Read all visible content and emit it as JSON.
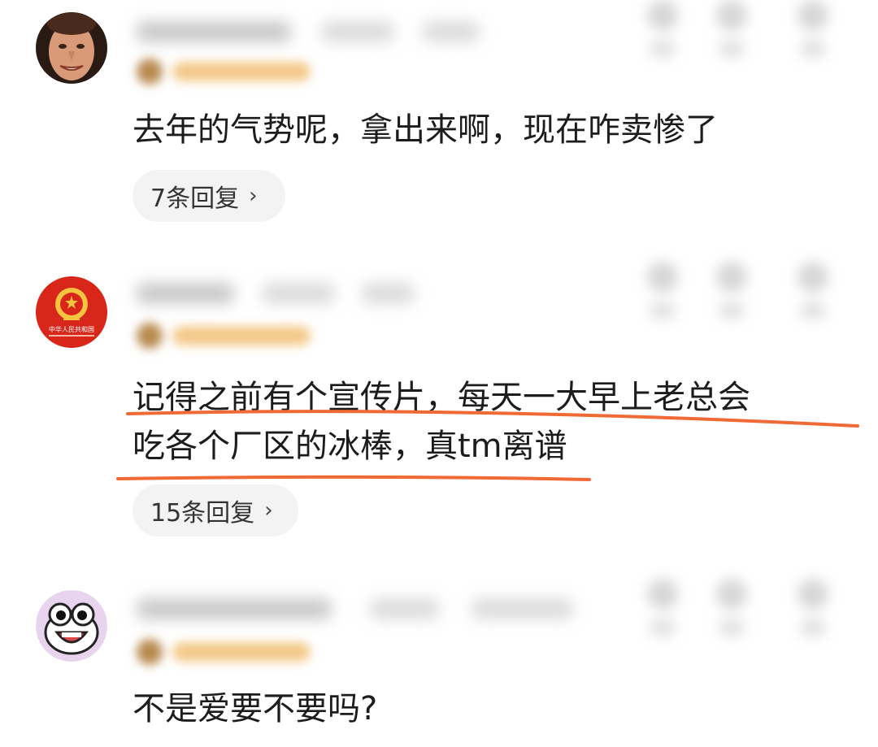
{
  "comments": [
    {
      "text_lines": [
        "去年的气势呢，拿出来啊，现在咋卖惨了"
      ],
      "reply_label": "7条回复",
      "reply_chevron": "›",
      "avatar_icon": "face-photo-avatar"
    },
    {
      "text_lines": [
        "记得之前有个宣传片，每天一大早上老总会",
        "吃各个厂区的冰棒，真tm离谱"
      ],
      "reply_label": "15条回复",
      "reply_chevron": "›",
      "avatar_icon": "national-emblem-avatar",
      "avatar_caption": "中华人民共和国"
    },
    {
      "text_lines": [
        "不是爱要不要吗?"
      ],
      "avatar_icon": "cartoon-face-avatar"
    }
  ],
  "colors": {
    "underline": "#f06a35",
    "emblem_red": "#d8261b",
    "emblem_gold": "#f5c542"
  }
}
